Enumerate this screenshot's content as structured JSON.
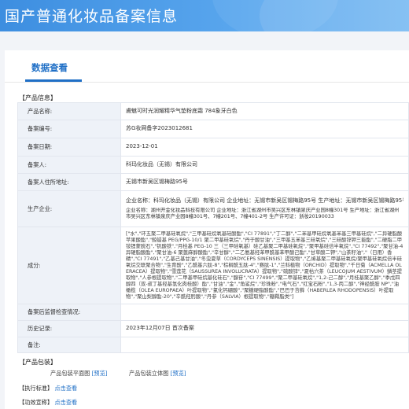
{
  "banner": {
    "title": "国产普通化妆品备案信息"
  },
  "tabs": {
    "active": "数据查看"
  },
  "product_info": {
    "heading": "【产品信息】",
    "rows": [
      {
        "label": "产品名称:",
        "value": "膚魅可时光润耀精华气垫粉底霜 784象牙白色"
      },
      {
        "label": "备案编号:",
        "value": "苏G妆网备字2023012681"
      },
      {
        "label": "备案日期:",
        "value": "2023-12-01"
      },
      {
        "label": "备案人:",
        "value": "科玛化妆品（无锡）有限公司"
      },
      {
        "label": "备案人住所地址:",
        "value": "无锡市新吴区锡梅路95号"
      },
      {
        "label": "生产企业:",
        "value": "企业名称：科玛化妆品（无锡）有限公司 企业地址：无锡市新吴区锡梅路95号 生产地址：无锡市新吴区锡梅路95号 生产许可证：苏妆20180016",
        "value2": "企业名称：湖州开金化妆品科技有限公司 企业地址：浙江省湖州市吴兴区东林镇泉庆产业园8幢301号 生产地址：浙江省湖州市吴兴区东林镇泉庆产业园8幢301号、7幢201号、7幢401-2号 生产许可证：浙妆20190033"
      },
      {
        "label": "成分:",
        "value": "[\"水\",\"环五聚二甲基硅氧烷\",\"三甲基硅烷氧基硅酸酯\",\"CI 77891\",\"丁二醇\",\"二苯基甲硅烷氧基苯基三甲基硅烷\",\"二异硬脂酸苹果酸酯\",\"鲸蜡基 PEG/PPG-10/1 聚二甲基硅氧烷\",\"丹于酸甘油\",\"三甲基五苯基三硅氧烷\",\"三硅酸锌钾三能酯\",\"二硬脂二甲铵锂蒙脱石\",\"钒酸铁\",\"月桂基 PEG-10 三（三甲硅氧基）硅乙基聚二甲基硅氧烷\",\"聚甲基硅倍半氧烷\",\"CI 77492\",\"聚甘油-4 异硬脂酸酯\",\"聚甘油-6 聚蓖麻醇酸酯\",\"辛甘醇\",\"二乙氨基羟苯甲酰基苯甲酸己酯\",\"甘草酸二钾\",\"山茶籽油\",\"（日用）香精\",\"CI 77491\",\"乙基己基甘油\",\"冬虫夏草（CORDYCEPS SINENSIS）提取物\",\"乙烯基聚二甲基硅氧烷/聚甲基硅氧烷倍半硅氧烷交联聚合物\",\"生育酚\",\"乙酰基六肽-8\",\"棕榈酰五肽-4\",\"赛肽-1\",\"兰科植物（ORCHID）提取物\",\"千日菊（ACMELLA OLERACEA）提取物\",\"雪莲花（SAUSSUREA INVOLUCRATA）提取物\",\"硫酸锌\",\"夏枯穴茶（LEUCOJUM AESTIVUM）鳞茎提取物\",\"人参根提取物\",\"二甲基甲硅烷基化硅石\",\"腺苷\",\"CI 77499\",\"聚二甲基硅氧烷\",\"1,2-己二醇\",\"月桂基聚乙醇\",\"季戊四醇四（双-叔丁基羟基氢化肉桂酸）酯\",\"甘油\",\"金\",\"角鲨烷\",\"珍珠粉\",\"电气石\",\"红宝石粉\",\"1,3-丙二醇\",\"神经酰胺 NP\",\"油橄榄（OLEA EUROPAEA）叶提取物\",\"氯化钙硼酸\",\"聚糖硬脂酸酯\",\"巴巴于苔藓（HABERLEA RHODOPENSIS）叶提取物\",\"聚山梨醇酯-20\",\"辛酰羟肟酸\",\"丹参（SALVIA）根提取物\",\"糖鞘脂类\"]"
      },
      {
        "label": "备案后监督检查情况:",
        "value": ""
      },
      {
        "label": "历史记录:",
        "value": "2023年12月07日 首次备案"
      },
      {
        "label": "备注:",
        "value": ""
      }
    ]
  },
  "packaging": {
    "heading": "【产品包装】",
    "flat_label": "产品包装平面图",
    "flat_link": "[预览]",
    "3d_label": "产品包装立体图",
    "3d_link": "[预览]"
  },
  "standard": {
    "heading": "【执行标准】",
    "link": "点击查看"
  },
  "efficacy": {
    "heading": "【功效宣称】",
    "link": "点击查看"
  },
  "colors": {
    "banner": "#4a9ae8",
    "accent": "#1f6fc6",
    "label_bg": "#eef2f8"
  }
}
